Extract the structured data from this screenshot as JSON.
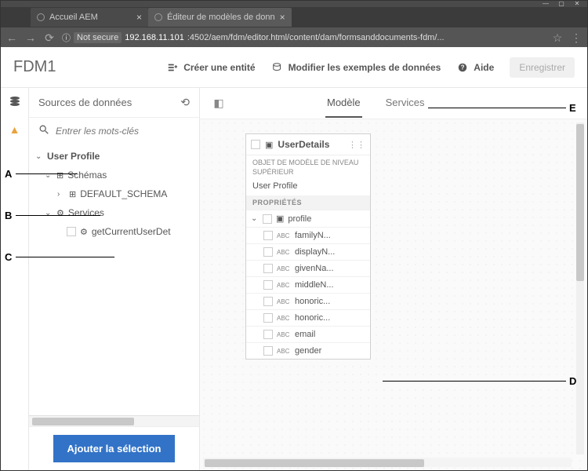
{
  "browser": {
    "tabs": [
      {
        "label": "Accueil AEM",
        "active": false
      },
      {
        "label": "Éditeur de modèles de donn",
        "active": true
      }
    ],
    "insecure_label": "Not secure",
    "url_host": "192.168.11.101",
    "url_port_path": ":4502/aem/fdm/editor.html/content/dam/formsanddocuments-fdm/..."
  },
  "toolbar": {
    "title": "FDM1",
    "create_entity": "Créer une entité",
    "modify_samples": "Modifier les exemples de données",
    "help": "Aide",
    "save": "Enregistrer"
  },
  "sidebar": {
    "header": "Sources de données",
    "search_placeholder": "Entrer les mots-clés",
    "tree": {
      "root": "User Profile",
      "schemas": "Schémas",
      "default_schema": "DEFAULT_SCHEMA",
      "services": "Services",
      "service_item": "getCurrentUserDet"
    },
    "add_selection": "Ajouter la sélection"
  },
  "main": {
    "tab_model": "Modèle",
    "tab_services": "Services"
  },
  "entity": {
    "title": "UserDetails",
    "subtitle": "OBJET DE MODÈLE DE NIVEAU SUPÉRIEUR",
    "source": "User Profile",
    "section_props": "PROPRIÉTÉS",
    "profile": "profile",
    "props": [
      "familyN...",
      "displayN...",
      "givenNa...",
      "middleN...",
      "honoric...",
      "honoric...",
      "email",
      "gender"
    ]
  },
  "annotations": {
    "A": "A",
    "B": "B",
    "C": "C",
    "D": "D",
    "E": "E"
  }
}
